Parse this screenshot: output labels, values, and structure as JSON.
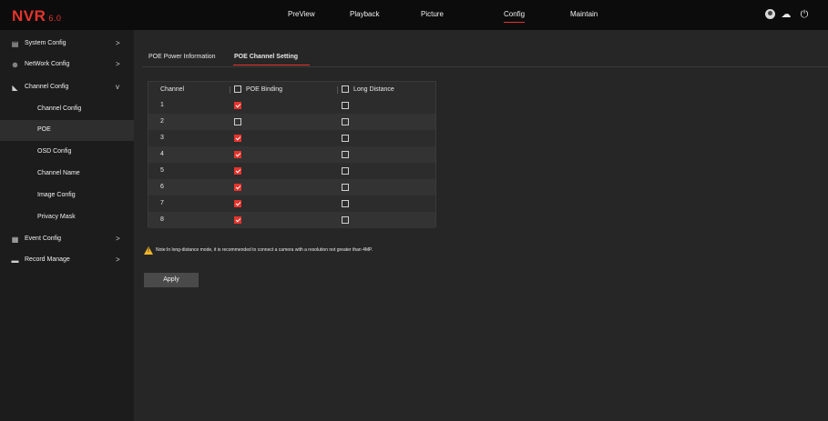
{
  "app": {
    "logo": "NVR",
    "version": "6.0"
  },
  "nav": [
    "PreView",
    "Playback",
    "Picture",
    "Config",
    "Maintain"
  ],
  "nav_active": "Config",
  "top_icons": [
    "user-avatar-icon",
    "cloud-upload-icon",
    "power-icon"
  ],
  "sidebar": {
    "items": [
      {
        "label": "System Config",
        "icon": "system-icon",
        "arrow": ">"
      },
      {
        "label": "NetWork Config",
        "icon": "network-icon",
        "arrow": ">"
      },
      {
        "label": "Channel Config",
        "icon": "camera-icon",
        "arrow": "v"
      },
      {
        "label": "Event Config",
        "icon": "event-icon",
        "arrow": ">"
      },
      {
        "label": "Record Manage",
        "icon": "record-icon",
        "arrow": ">"
      }
    ],
    "sub_items": [
      {
        "label": "Channel Config"
      },
      {
        "label": "POE"
      },
      {
        "label": "OSD Config"
      },
      {
        "label": "Channel Name"
      },
      {
        "label": "Image Config"
      },
      {
        "label": "Privacy Mask"
      }
    ],
    "active_sub": "POE"
  },
  "tabs": [
    {
      "label": "POE Power Information"
    },
    {
      "label": "POE Channel Setting"
    }
  ],
  "active_tab": "POE Channel Setting",
  "table": {
    "headers": [
      "Channel",
      "POE Binding",
      "Long Distance"
    ],
    "rows": [
      {
        "channel": "1",
        "poe_binding": true,
        "long_distance": false
      },
      {
        "channel": "2",
        "poe_binding": false,
        "long_distance": false
      },
      {
        "channel": "3",
        "poe_binding": true,
        "long_distance": false
      },
      {
        "channel": "4",
        "poe_binding": true,
        "long_distance": false
      },
      {
        "channel": "5",
        "poe_binding": true,
        "long_distance": false
      },
      {
        "channel": "6",
        "poe_binding": true,
        "long_distance": false
      },
      {
        "channel": "7",
        "poe_binding": true,
        "long_distance": false
      },
      {
        "channel": "8",
        "poe_binding": true,
        "long_distance": false
      }
    ]
  },
  "note": "Note:In long-distance mode, it is recommended to connect a camera with a resolution not greater than 4MP.",
  "apply_label": "Apply",
  "colors": {
    "accent": "#e5342d",
    "warning": "#f1b52a"
  }
}
